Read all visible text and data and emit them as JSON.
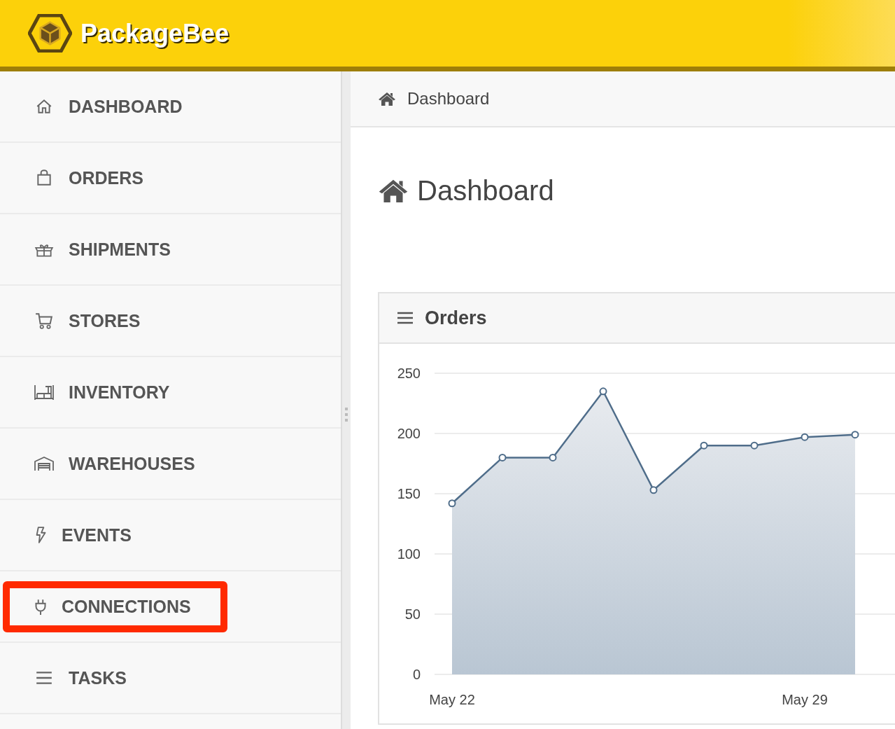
{
  "app": {
    "name": "PackageBee"
  },
  "sidebar": {
    "items": [
      {
        "label": "DASHBOARD",
        "highlighted": false
      },
      {
        "label": "ORDERS",
        "highlighted": false
      },
      {
        "label": "SHIPMENTS",
        "highlighted": false
      },
      {
        "label": "STORES",
        "highlighted": false
      },
      {
        "label": "INVENTORY",
        "highlighted": false
      },
      {
        "label": "WAREHOUSES",
        "highlighted": false
      },
      {
        "label": "EVENTS",
        "highlighted": false
      },
      {
        "label": "CONNECTIONS",
        "highlighted": true
      },
      {
        "label": "TASKS",
        "highlighted": false
      }
    ]
  },
  "breadcrumb": "Dashboard",
  "page_title": "Dashboard",
  "card": {
    "title": "Orders",
    "chart_data": {
      "type": "area",
      "categories": [
        "May 22",
        null,
        null,
        null,
        null,
        null,
        null,
        "May 29",
        null
      ],
      "series": [
        {
          "color": "#4f6d8a",
          "values": [
            142,
            180,
            180,
            235,
            153,
            190,
            190,
            197,
            199
          ]
        }
      ],
      "ylim": [
        0,
        250
      ],
      "grid": true,
      "yticks": [
        0,
        50,
        100,
        150,
        200,
        250
      ]
    }
  }
}
